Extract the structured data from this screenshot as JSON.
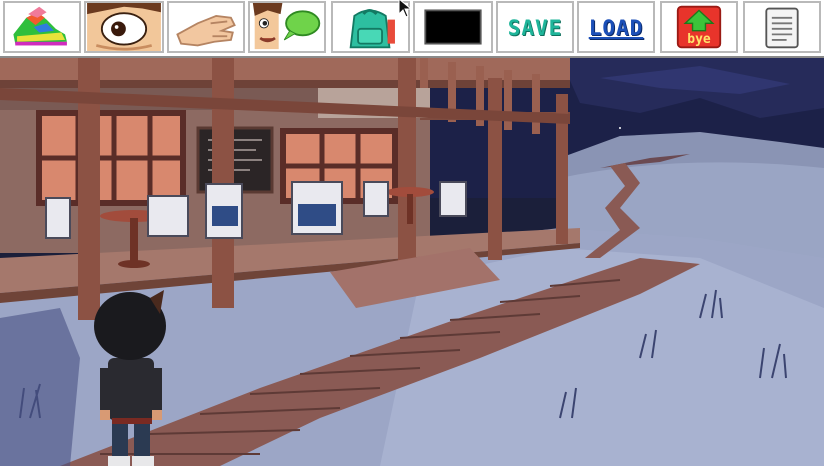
{
  "toolbar": {
    "actions": [
      {
        "id": "walk",
        "icon": "sneaker-icon"
      },
      {
        "id": "look",
        "icon": "eye-icon"
      },
      {
        "id": "use",
        "icon": "hand-icon"
      },
      {
        "id": "talk",
        "icon": "face-speech-bubble-icon"
      },
      {
        "id": "inventory",
        "icon": "backpack-icon"
      }
    ],
    "selected_item": {
      "icon": "empty-item-slot",
      "color": "#000000"
    },
    "save_label": "SAVE",
    "load_label": "LOAD",
    "quit_label": "bye",
    "notes_icon": "notepad-icon"
  },
  "colors": {
    "save": "#1fb59a",
    "load": "#1b4fb8",
    "quit_bg": "#e8342b",
    "quit_arrow": "#3cc43a",
    "night_sky": "#1b1f3a"
  },
  "scene": {
    "setting": "night-cafe-boardwalk",
    "character": "hooded-player-character"
  }
}
